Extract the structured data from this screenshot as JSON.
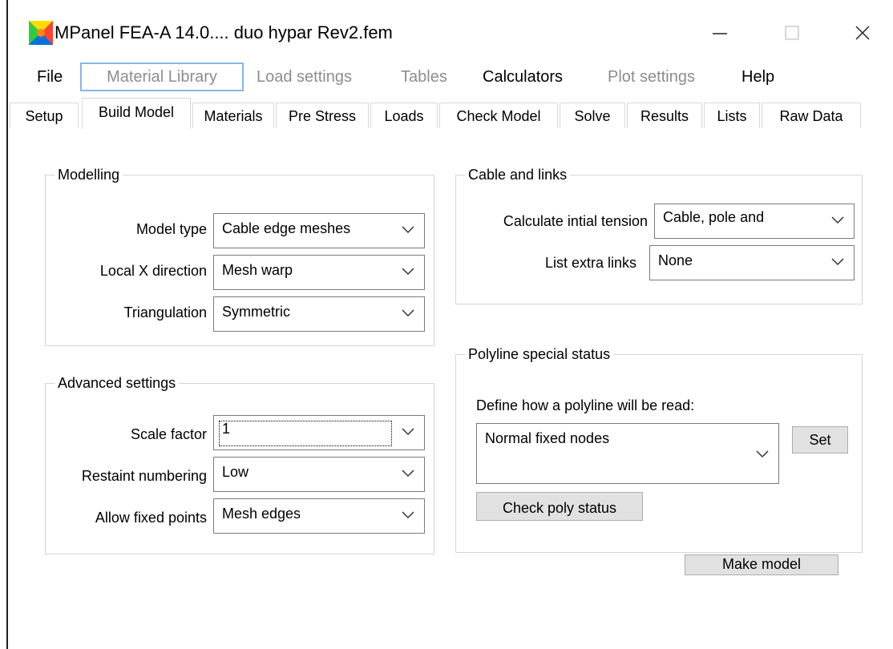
{
  "window": {
    "title": "MPanel FEA-A 14.0.... duo hypar Rev2.fem",
    "controls": {
      "minimize": "—",
      "maximize": "☐",
      "close": "✕"
    }
  },
  "menu": [
    {
      "label": "File",
      "enabled": true
    },
    {
      "label": "Material Library",
      "enabled": false
    },
    {
      "label": "Load settings",
      "enabled": false
    },
    {
      "label": "Tables",
      "enabled": false
    },
    {
      "label": "Calculators",
      "enabled": true
    },
    {
      "label": "Plot settings",
      "enabled": false
    },
    {
      "label": "Help",
      "enabled": true
    }
  ],
  "tabs": [
    "Setup",
    "Build Model",
    "Materials",
    "Pre Stress",
    "Loads",
    "Check Model",
    "Solve",
    "Results",
    "Lists",
    "Raw Data"
  ],
  "active_tab": "Build Model",
  "modelling": {
    "title": "Modelling",
    "model_type": {
      "label": "Model type",
      "value": "Cable edge meshes"
    },
    "local_x": {
      "label": "Local X direction",
      "value": "Mesh warp"
    },
    "triangulation": {
      "label": "Triangulation",
      "value": "Symmetric"
    }
  },
  "advanced": {
    "title": "Advanced settings",
    "scale_factor": {
      "label": "Scale factor",
      "value": "1"
    },
    "restraint_numbering": {
      "label": "Restaint numbering",
      "value": "Low"
    },
    "allow_fixed_points": {
      "label": "Allow fixed points",
      "value": "Mesh edges"
    }
  },
  "cable_links": {
    "title": "Cable and links",
    "initial_tension": {
      "label": "Calculate intial tension",
      "value": "Cable, pole and"
    },
    "extra_links": {
      "label": "List extra links",
      "value": "None"
    }
  },
  "polyline": {
    "title": "Polyline special status",
    "prompt": "Define how a polyline will be read:",
    "status_value": "Normal fixed nodes",
    "set_button": "Set",
    "check_button": "Check poly status"
  },
  "make_model_button": "Make model",
  "colors": {
    "disabled_text": "#8d8d8d",
    "focus_border": "#86b6e8",
    "button_face": "#e1e1e1"
  }
}
